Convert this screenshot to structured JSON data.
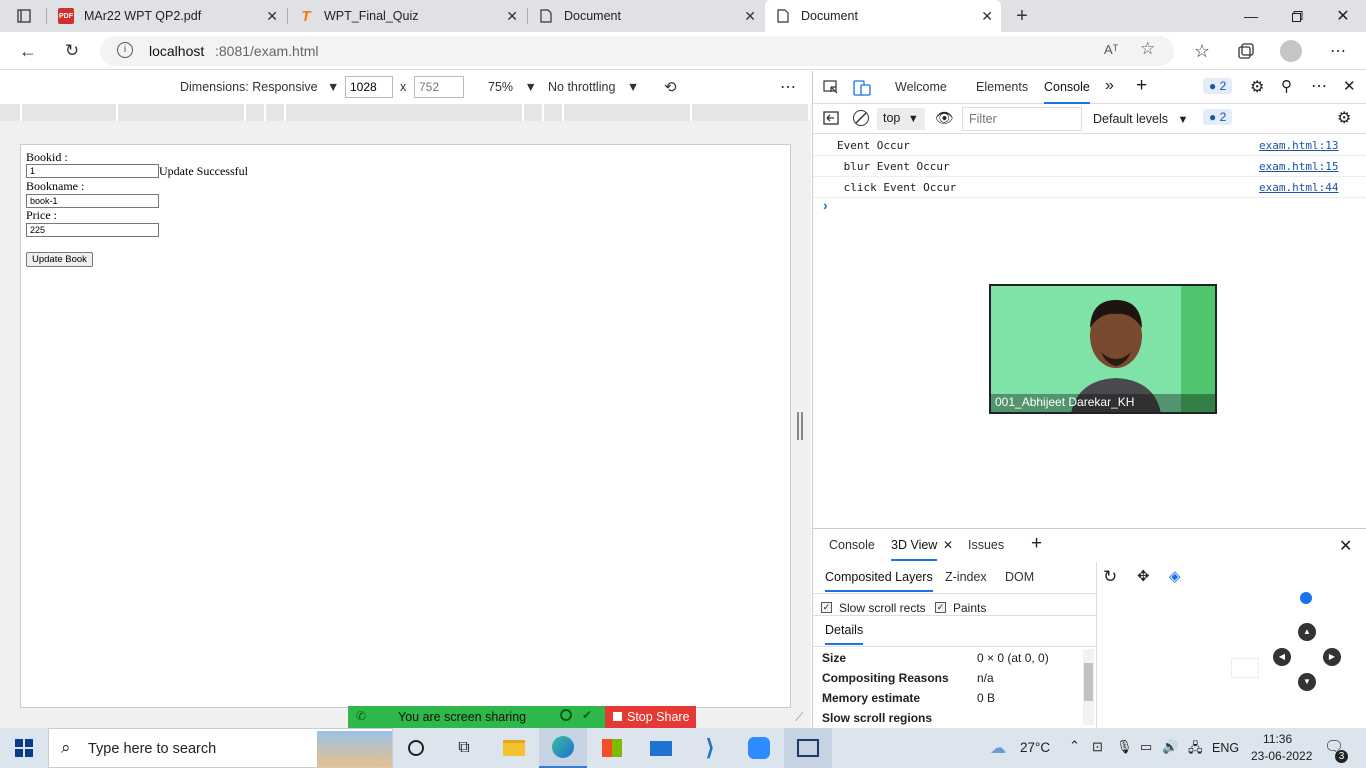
{
  "browser": {
    "tabs": [
      {
        "title": "MAr22 WPT QP2.pdf",
        "icon": "pdf-icon"
      },
      {
        "title": "WPT_Final_Quiz",
        "icon": "quiz-logo-icon"
      },
      {
        "title": "Document",
        "icon": "document-icon"
      },
      {
        "title": "Document",
        "icon": "document-icon"
      }
    ],
    "url_host": "localhost",
    "url_rest": ":8081/exam.html",
    "reader_label": "Aᵀ"
  },
  "device_toolbar": {
    "dimensions": "Dimensions: Responsive",
    "width": "1028",
    "times": "x",
    "height": "752",
    "zoom": "75%",
    "throttling": "No throttling"
  },
  "page": {
    "bookid_label": "Bookid :",
    "bookid_value": "1",
    "status": "Update Successful",
    "bookname_label": "Bookname :",
    "bookname_value": "book-1",
    "price_label": "Price :",
    "price_value": "225",
    "update_button": "Update Book"
  },
  "devtools": {
    "tabs": [
      "Welcome",
      "Elements",
      "Console"
    ],
    "active_tab": "Console",
    "issues_count": "2",
    "context": "top",
    "filter_placeholder": "Filter",
    "levels": "Default levels",
    "console_lines": [
      {
        "text": "Event Occur",
        "source": "exam.html:13"
      },
      {
        "text": " blur Event Occur",
        "source": "exam.html:15"
      },
      {
        "text": " click Event Occur",
        "source": "exam.html:44"
      }
    ],
    "prompt": "›",
    "video_caption": "001_Abhijeet Darekar_KH",
    "drawer_tabs": [
      "Console",
      "3D View",
      "Issues"
    ],
    "view_tabs": [
      "Composited Layers",
      "Z-index",
      "DOM"
    ],
    "checkbox1": "Slow scroll rects",
    "checkbox2": "Paints",
    "details_tab": "Details",
    "details": [
      {
        "key": "Size",
        "value": "0 × 0 (at 0, 0)"
      },
      {
        "key": "Compositing Reasons",
        "value": "n/a"
      },
      {
        "key": "Memory estimate",
        "value": "0 B"
      },
      {
        "key": "Slow scroll regions",
        "value": ""
      }
    ]
  },
  "screen_share": {
    "label": "You are screen sharing",
    "stop": "Stop Share"
  },
  "taskbar": {
    "search_placeholder": "Type here to search",
    "weather": "27°C",
    "language": "ENG",
    "time": "11:36",
    "date": "23-06-2022",
    "notifications": "3"
  },
  "colors": {
    "accent": "#1a73e8",
    "share_green": "#2fb84a",
    "stop_red": "#e53935"
  }
}
